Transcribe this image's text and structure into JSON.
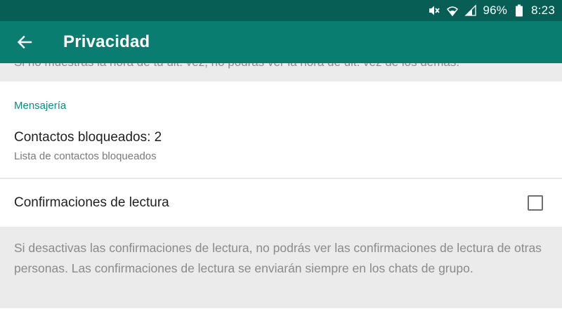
{
  "status_bar": {
    "battery": "96%",
    "time": "8:23",
    "icons": [
      "mute-icon",
      "wifi-icon",
      "signal-icon",
      "battery-icon"
    ]
  },
  "app_bar": {
    "title": "Privacidad",
    "back_icon": "arrow-left-icon"
  },
  "previous_section": {
    "note": "Si no muestras la hora de tu últ. vez, no podrás ver la hora de últ. vez de los demás."
  },
  "messaging": {
    "header": "Mensajería",
    "blocked_contacts": {
      "title": "Contactos bloqueados: 2",
      "subtitle": "Lista de contactos bloqueados"
    },
    "read_receipts": {
      "title": "Confirmaciones de lectura",
      "checked": false
    },
    "read_receipts_info": "Si desactivas las confirmaciones de lectura, no podrás ver las confirmaciones de lectura de otras personas. Las confirmaciones de lectura se enviarán siempre en los chats de grupo."
  },
  "colors": {
    "status_bar": "#075e54",
    "app_bar": "#0a7d71",
    "accent": "#0a8d7f",
    "info_background": "#ebebeb"
  }
}
